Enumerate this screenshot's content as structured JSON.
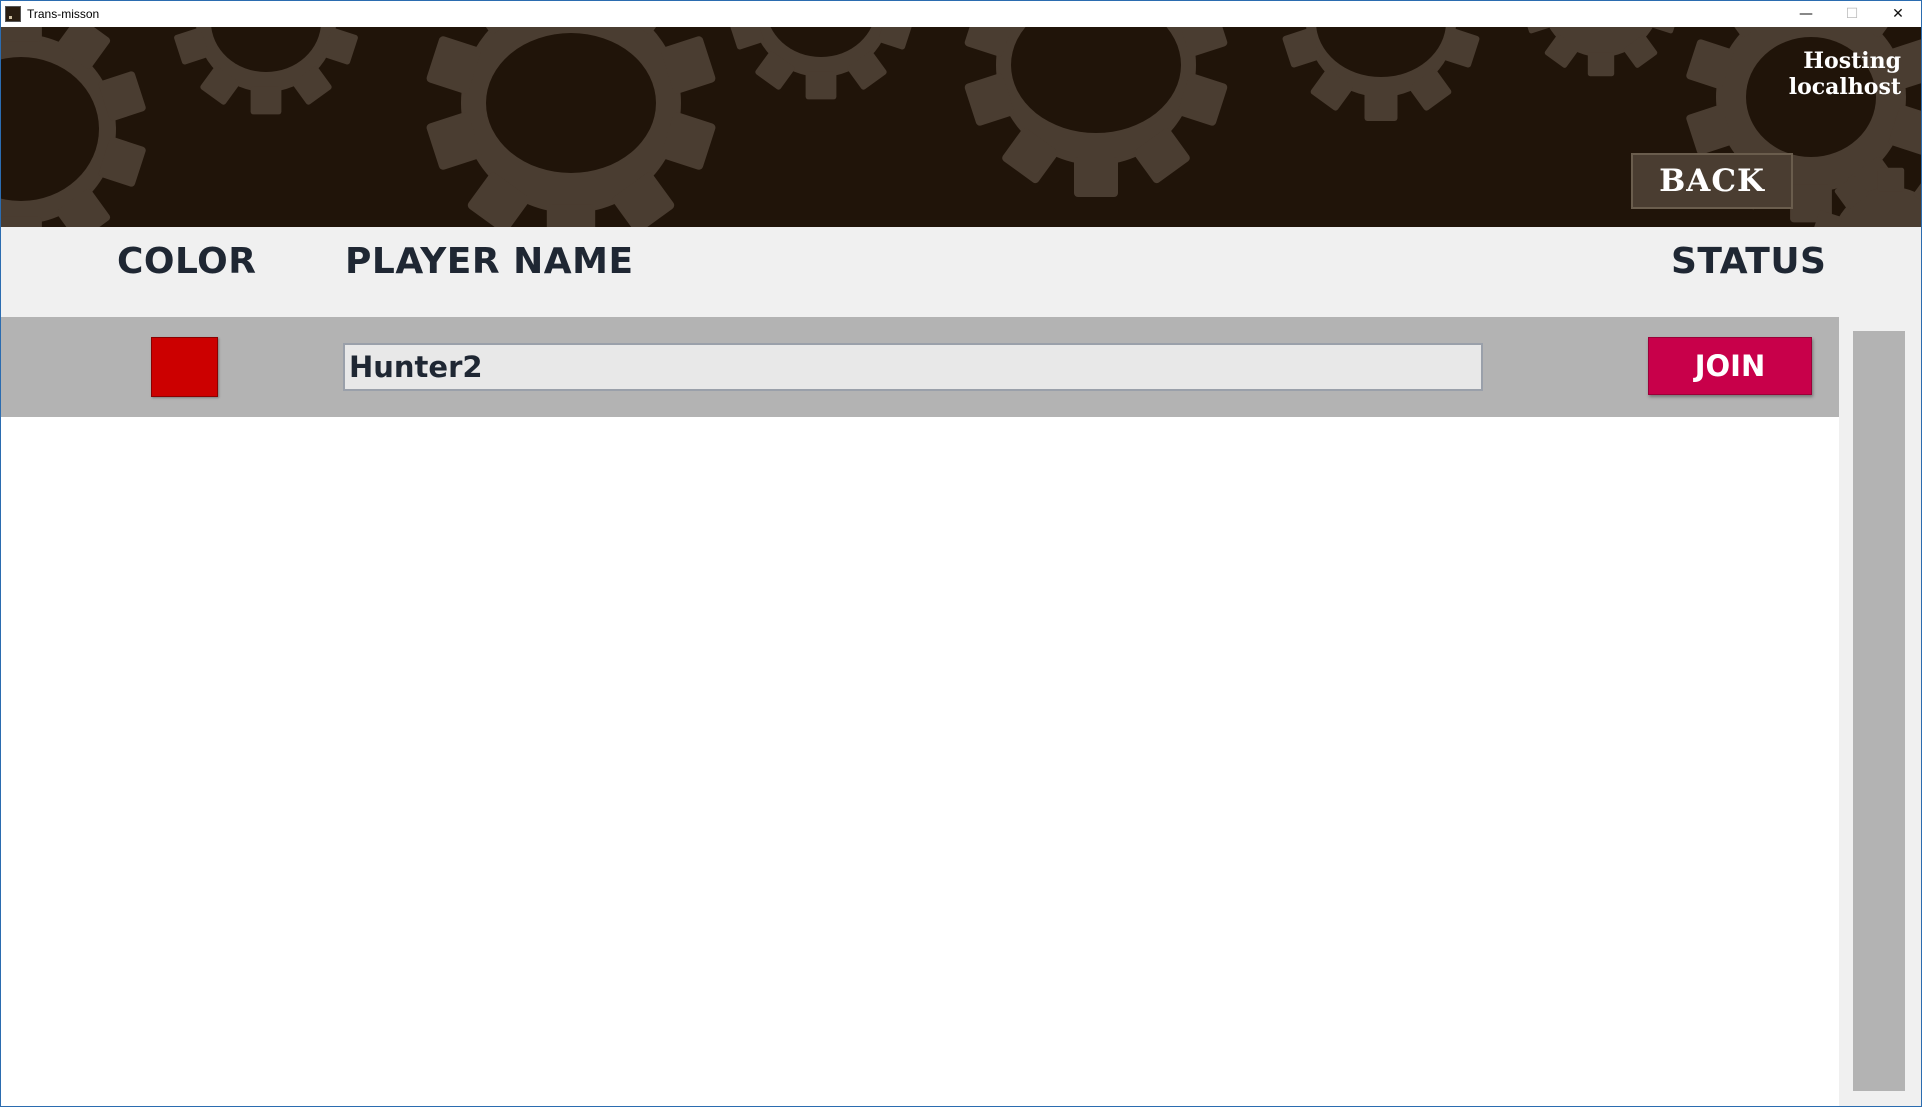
{
  "window": {
    "title": "Trans-misson",
    "controls": {
      "minimize": "—",
      "maximize": "☐",
      "close": "✕"
    }
  },
  "header": {
    "hosting_label": "Hosting",
    "host_name": "localhost",
    "back_label": "BACK"
  },
  "columns": {
    "color": "COLOR",
    "player_name": "PLAYER NAME",
    "status": "STATUS"
  },
  "players": [
    {
      "color": "#cc0000",
      "name": "Hunter2",
      "status_action": "JOIN"
    }
  ],
  "colors": {
    "banner_bg": "#201409",
    "gear": "#4a3d31",
    "join": "#c8004a",
    "row_bg": "#b3b3b3",
    "header_text": "#1f2733"
  }
}
